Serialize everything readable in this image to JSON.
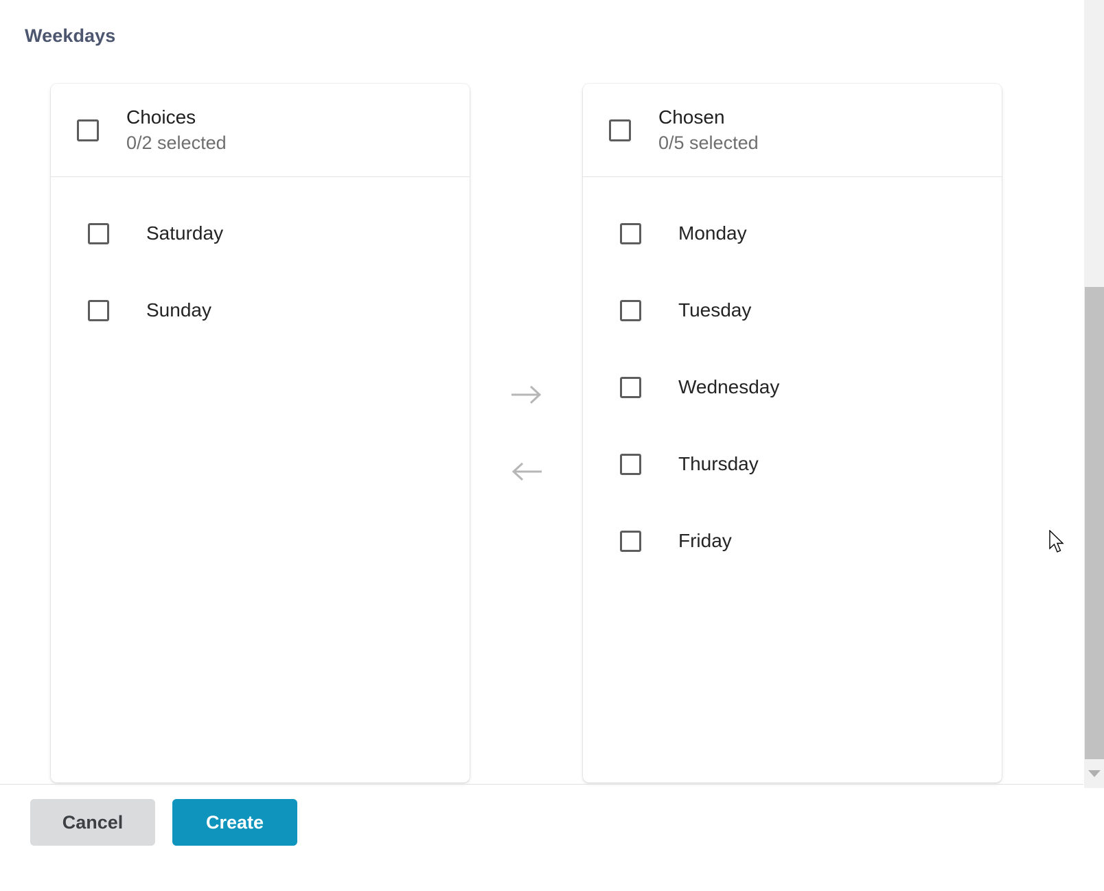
{
  "field": {
    "label": "Weekdays"
  },
  "dual_list": {
    "source": {
      "title": "Choices",
      "count_text": "0/2 selected",
      "select_all_checked": false,
      "items": [
        {
          "label": "Saturday",
          "checked": false
        },
        {
          "label": "Sunday",
          "checked": false
        }
      ]
    },
    "target": {
      "title": "Chosen",
      "count_text": "0/5 selected",
      "select_all_checked": false,
      "items": [
        {
          "label": "Monday",
          "checked": false
        },
        {
          "label": "Tuesday",
          "checked": false
        },
        {
          "label": "Wednesday",
          "checked": false
        },
        {
          "label": "Thursday",
          "checked": false
        },
        {
          "label": "Friday",
          "checked": false
        }
      ]
    },
    "transfer": {
      "to_chosen_icon": "arrow-right-icon",
      "to_choices_icon": "arrow-left-icon"
    }
  },
  "actions": {
    "cancel_label": "Cancel",
    "create_label": "Create"
  },
  "colors": {
    "label_text": "#4c566e",
    "primary_button": "#0f95bd",
    "secondary_button": "#d9dbdd",
    "checkbox_border": "#5d5d5d",
    "arrow_gray": "#b6b6b6",
    "divider": "#e0e0e0",
    "scrollbar_track": "#f1f1f1",
    "scrollbar_thumb": "#c1c1c1"
  },
  "scrollbar": {
    "down_arrow_icon": "chevron-down-icon"
  },
  "cursor": {
    "icon": "mouse-pointer-icon"
  }
}
